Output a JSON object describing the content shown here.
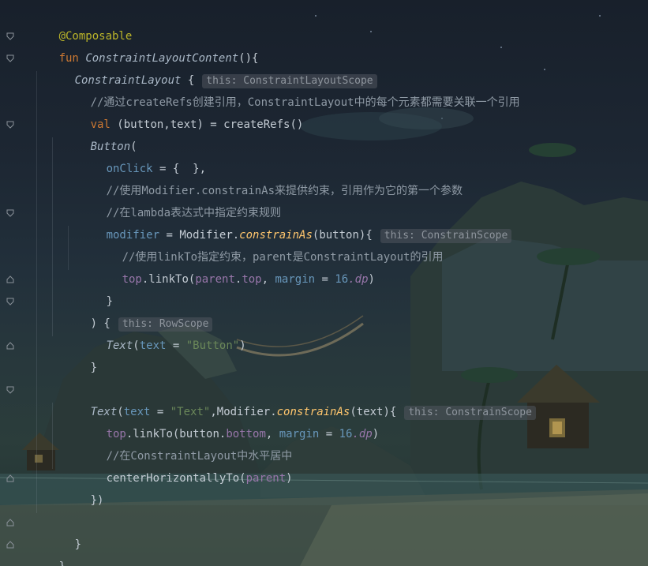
{
  "editor": {
    "theme_colors": {
      "keyword": "#cc7832",
      "annotation": "#bbb529",
      "function": "#ffc66d",
      "comment": "#8f9aa5",
      "named_param": "#6897bb",
      "property": "#9876aa",
      "string": "#6a8759",
      "number": "#6897bb"
    },
    "lines": [
      {
        "annotation": "@Composable"
      },
      {
        "kw": "fun",
        "name": "ConstraintLayoutContent",
        "rest": "(){"
      },
      {
        "call": "ConstraintLayout",
        "rest": " {",
        "hint": "this: ConstraintLayoutScope"
      },
      {
        "comment": "//通过createRefs创建引用，ConstraintLayout中的每个元素都需要关联一个引用"
      },
      {
        "kw": "val",
        "rest": " (button,text) = createRefs()"
      },
      {
        "call": "Button",
        "rest": "("
      },
      {
        "param": "onClick",
        "rest": " = {  },"
      },
      {
        "comment": "//使用Modifier.constrainAs来提供约束，引用作为它的第一个参数"
      },
      {
        "comment": "//在lambda表达式中指定约束规则"
      },
      {
        "param": "modifier",
        "eq": " = ",
        "obj": "Modifier.",
        "fn": "constrainAs",
        "rest": "(button){",
        "hint": "this: ConstrainScope"
      },
      {
        "comment": "//使用linkTo指定约束，parent是ConstraintLayout的引用"
      },
      {
        "prop": "top",
        "call": ".linkTo(",
        "arg": "parent",
        "dot": ".",
        "arg_prop": "top",
        "sep": ", ",
        "param": "margin",
        "eq": " = ",
        "num": "16",
        "unit": ".dp",
        "close": ")"
      },
      {
        "text": "}"
      },
      {
        "text": ") {",
        "hint": "this: RowScope"
      },
      {
        "call": "Text",
        "open": "(",
        "param": "text",
        "eq": " = ",
        "string": "\"Button\"",
        "close": ")"
      },
      {
        "text": "}"
      },
      {
        "text": ""
      },
      {
        "call": "Text",
        "open": "(",
        "param": "text",
        "eq": " = ",
        "string": "\"Text\"",
        "sep": ",",
        "obj": "Modifier.",
        "fn": "constrainAs",
        "rest": "(text){",
        "hint": "this: ConstrainScope"
      },
      {
        "prop": "top",
        "call": ".linkTo(button.",
        "arg_prop": "bottom",
        "sep": ", ",
        "param": "margin",
        "eq": " = ",
        "num": "16",
        "unit": ".dp",
        "close": ")"
      },
      {
        "comment": "//在ConstraintLayout中水平居中"
      },
      {
        "text": "centerHorizontallyTo(",
        "arg": "parent",
        "close": ")"
      },
      {
        "text": "})"
      },
      {
        "text": ""
      },
      {
        "text": "}"
      },
      {
        "text": "}"
      }
    ]
  }
}
